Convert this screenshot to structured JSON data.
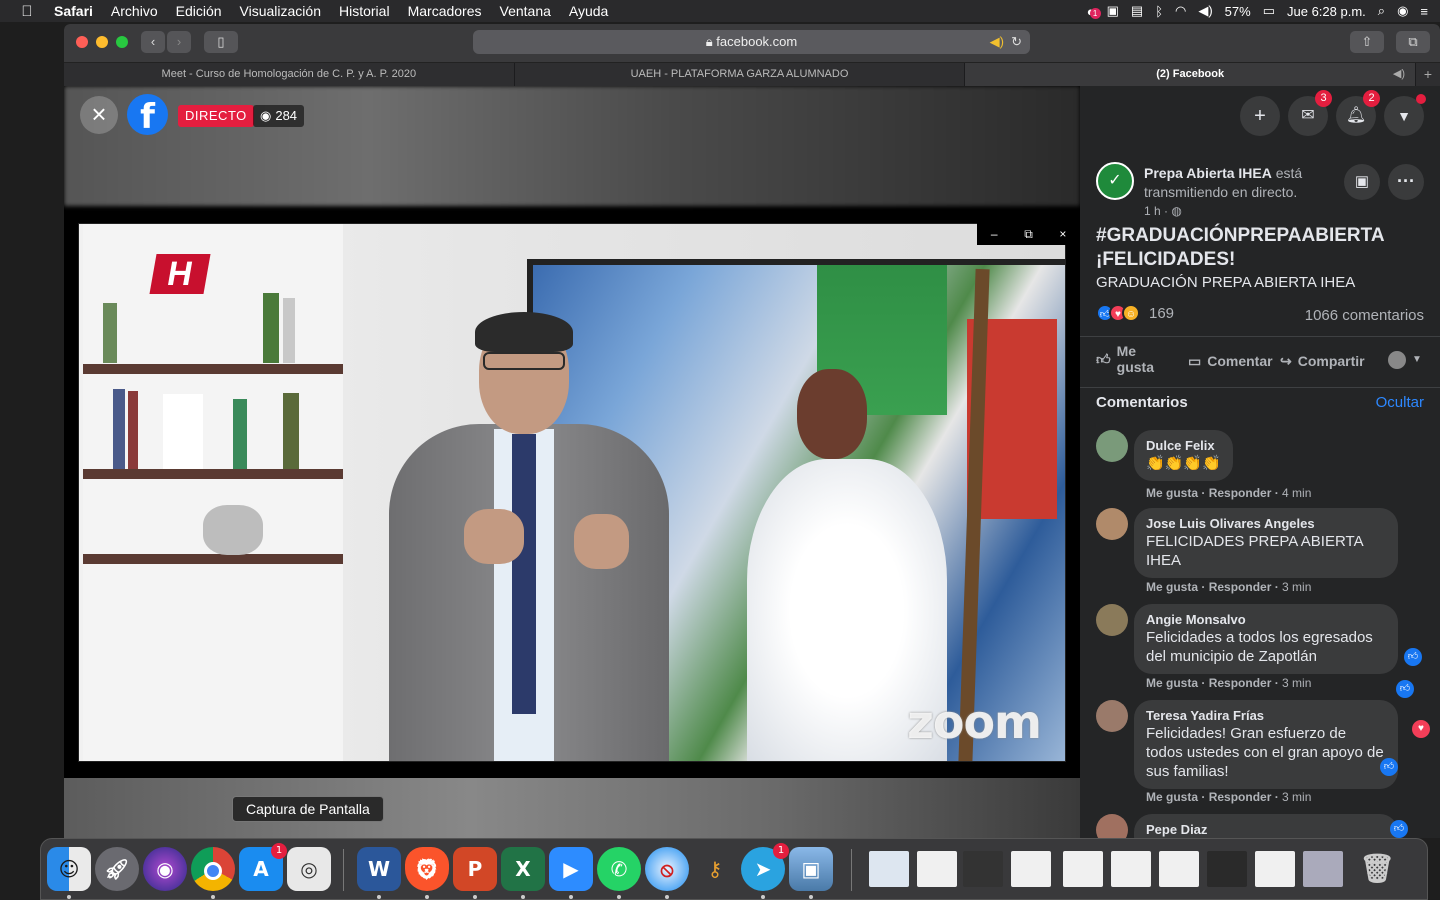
{
  "menubar": {
    "app_name": "Safari",
    "menus": [
      "Archivo",
      "Edición",
      "Visualización",
      "Historial",
      "Marcadores",
      "Ventana",
      "Ayuda"
    ],
    "battery": "57%",
    "clock": "Jue 6:28 p.m.",
    "notification_badge": "1"
  },
  "browser": {
    "url": "facebook.com",
    "tabs": [
      {
        "title": "Meet - Curso de Homologación de C. P. y A. P. 2020"
      },
      {
        "title": "UAEH - PLATAFORMA GARZA ALUMNADO"
      },
      {
        "title": "(2) Facebook"
      }
    ],
    "new_tab": "+"
  },
  "video": {
    "close_icon": "×",
    "fb_letter": "f",
    "live_label": "DIRECTO",
    "viewer_count": "284",
    "zoom_watermark": "zoom",
    "zoom_controls": [
      "–",
      "⧉",
      "×"
    ],
    "sep_logo_letter": "H"
  },
  "top_actions": {
    "messenger_badge": "3",
    "notifications_badge": "2"
  },
  "post": {
    "page_name": "Prepa Abierta IHEA",
    "status_text": "está transmitiendo en directo.",
    "time": "1 h ·",
    "title": "#GRADUACIÓNPREPAABIERTA ¡FELICIDADES!",
    "subtitle": "GRADUACIÓN PREPA ABIERTA IHEA",
    "reaction_count": "169",
    "comment_count": "1066 comentarios",
    "actions": {
      "like": "Me gusta",
      "comment": "Comentar",
      "share": "Compartir"
    }
  },
  "comments_section": {
    "header": "Comentarios",
    "hide_label": "Ocultar",
    "items": [
      {
        "name": "Dulce Felix",
        "text": "👏👏👏👏",
        "like": "Me gusta",
        "reply": "Responder",
        "time": "4 min",
        "avatar_color": "#7a9a7a"
      },
      {
        "name": "Jose Luis Olivares Angeles",
        "text": "FELICIDADES PREPA ABIERTA IHEA",
        "like": "Me gusta",
        "reply": "Responder",
        "time": "3 min",
        "avatar_color": "#b08a6a"
      },
      {
        "name": "Angie Monsalvo",
        "text": "Felicidades a todos los egresados del municipio de Zapotlán",
        "like": "Me gusta",
        "reply": "Responder",
        "time": "3 min",
        "avatar_color": "#8a7a5a"
      },
      {
        "name": "Teresa Yadira Frías",
        "text": "Felicidades! Gran esfuerzo de todos ustedes con el gran apoyo de sus familias!",
        "like": "Me gusta",
        "reply": "Responder",
        "time": "3 min",
        "avatar_color": "#9a7a6a"
      },
      {
        "name": "Pepe Diaz",
        "text": "",
        "like": "",
        "reply": "",
        "time": "",
        "avatar_color": "#a07060"
      }
    ]
  },
  "tooltip": "Captura de Pantalla",
  "dock": {
    "badges": {
      "appstore": "1",
      "telegram": "1"
    },
    "app_letters": {
      "word": "W",
      "powerpoint": "P",
      "excel": "X"
    }
  }
}
